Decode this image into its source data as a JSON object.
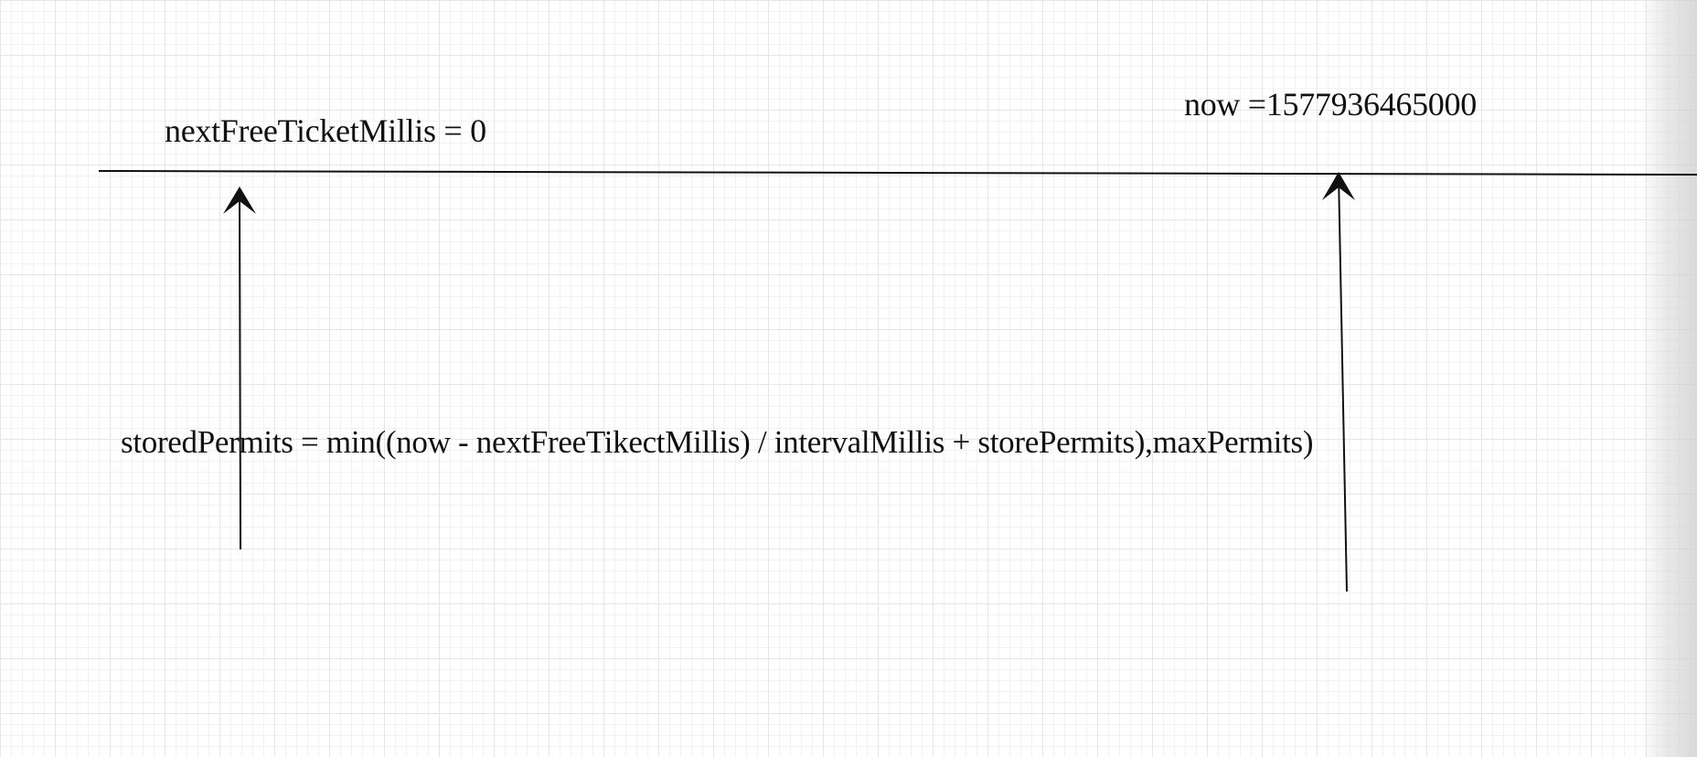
{
  "diagram": {
    "labels": {
      "next_free_ticket": "nextFreeTicketMillis = 0",
      "now": "now =1577936465000",
      "formula": "storedPermits = min((now - nextFreeTikectMillis) / intervalMillis + storePermits),maxPermits)"
    },
    "colors": {
      "background": "#ffffff",
      "grid": "#e6e6e6",
      "stroke": "#111111"
    }
  }
}
